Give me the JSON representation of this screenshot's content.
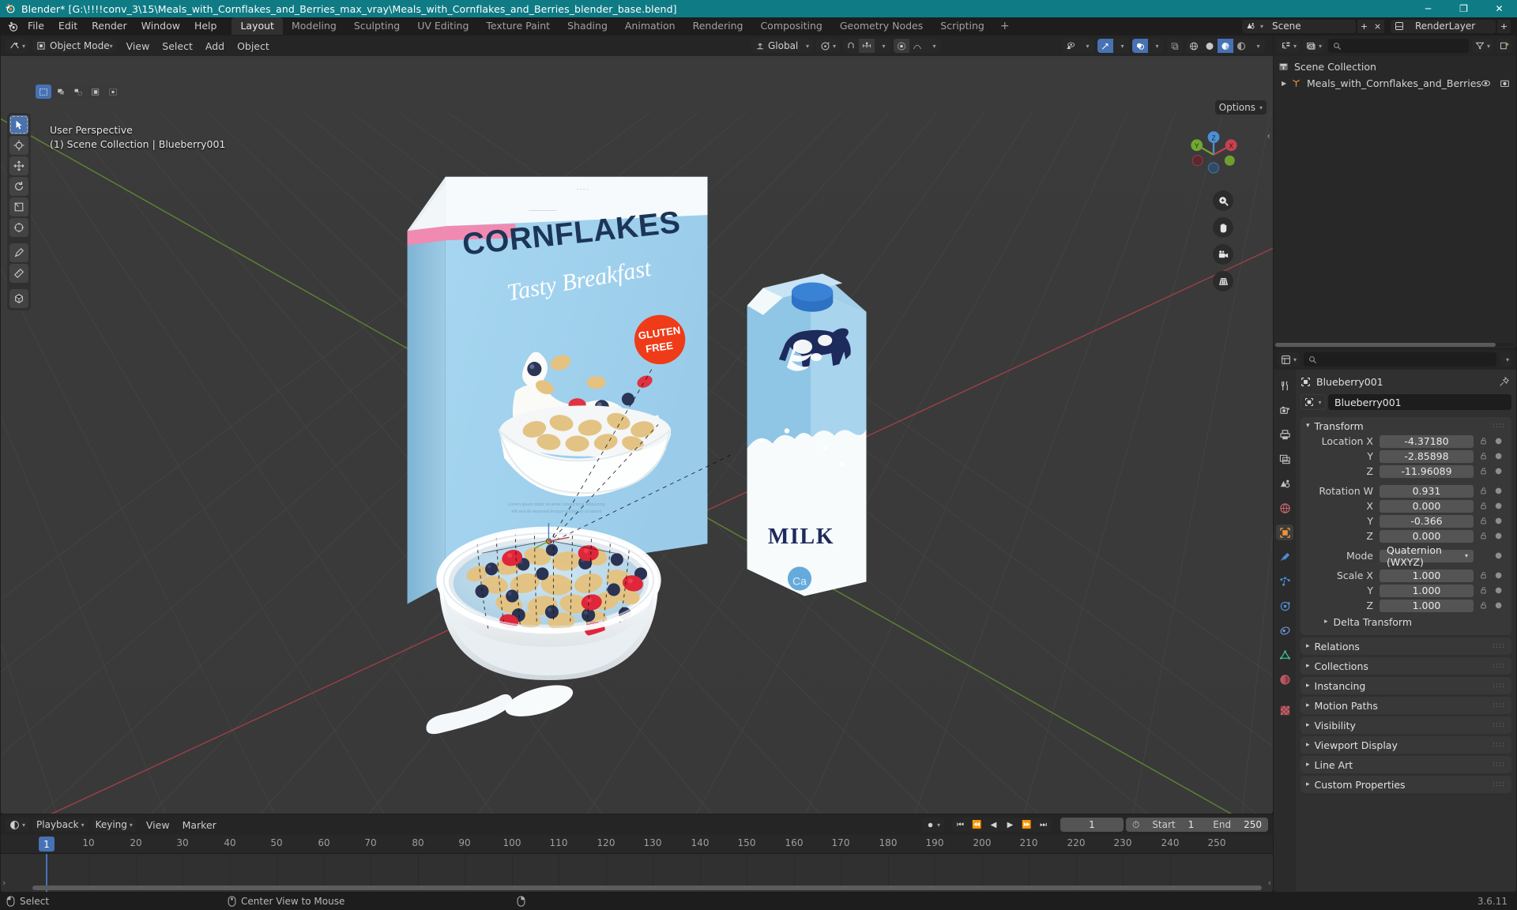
{
  "window": {
    "title": "Blender* [G:\\!!!!conv_3\\15\\Meals_with_Cornflakes_and_Berries_max_vray\\Meals_with_Cornflakes_and_Berries_blender_base.blend]",
    "minimize": "─",
    "maximize": "❐",
    "close": "✕",
    "titlebar_color": "#0f7b85"
  },
  "topbar": {
    "logo_icon": "blender-logo-icon",
    "menus": [
      "File",
      "Edit",
      "Render",
      "Window",
      "Help"
    ],
    "workspaces": [
      {
        "label": "Layout",
        "active": true
      },
      {
        "label": "Modeling",
        "active": false
      },
      {
        "label": "Sculpting",
        "active": false
      },
      {
        "label": "UV Editing",
        "active": false
      },
      {
        "label": "Texture Paint",
        "active": false
      },
      {
        "label": "Shading",
        "active": false
      },
      {
        "label": "Animation",
        "active": false
      },
      {
        "label": "Rendering",
        "active": false
      },
      {
        "label": "Compositing",
        "active": false
      },
      {
        "label": "Geometry Nodes",
        "active": false
      },
      {
        "label": "Scripting",
        "active": false
      }
    ],
    "add_workspace": "+",
    "scene_label": "Scene",
    "viewlayer_label": "RenderLayer"
  },
  "viewport": {
    "mode": "Object Mode",
    "menus": [
      "View",
      "Select",
      "Add",
      "Object"
    ],
    "transform_orientation": "Global",
    "overlay_line_1": "User Perspective",
    "overlay_line_2": "(1) Scene Collection | Blueberry001",
    "options_label": "Options",
    "gizmo_axes": [
      "X",
      "Y",
      "Z"
    ],
    "nav_buttons": [
      "zoom-icon",
      "hand-pan-icon",
      "camera-view-icon",
      "perspective-ortho-icon"
    ],
    "tools": [
      "tweak-select-tool",
      "cursor-tool",
      "move-tool",
      "rotate-tool",
      "scale-tool",
      "transform-tool",
      "annotate-tool",
      "measure-tool",
      "add-cube-tool"
    ],
    "select_modes": [
      "select-box",
      "select-circle",
      "select-lasso",
      "select-extend",
      "select-tweak"
    ],
    "bg_color": "#393939",
    "grid_color": "#5a5a5a",
    "axis_x_color": "#b9404c",
    "axis_y_color": "#6a9e2f"
  },
  "outliner": {
    "display_mode_icon": "outliner-view-layer-icon",
    "filter_icon": "filter-icon",
    "new_collection_icon": "new-collection-icon",
    "search_placeholder": "",
    "rows": [
      {
        "label": "Scene Collection",
        "icon": "scene-collection-icon",
        "indent": false,
        "expand": "",
        "eye": false,
        "cam": false
      },
      {
        "label": "Meals_with_Cornflakes_and_Berries",
        "icon": "empty-axes-icon",
        "indent": true,
        "expand": "▶",
        "eye": true,
        "cam": true
      }
    ]
  },
  "properties": {
    "search_placeholder": "",
    "tabs": [
      {
        "name": "tool-tab",
        "active": false
      },
      {
        "name": "render-tab",
        "active": false
      },
      {
        "name": "output-tab",
        "active": false
      },
      {
        "name": "view-layer-tab",
        "active": false
      },
      {
        "name": "scene-tab",
        "active": false
      },
      {
        "name": "world-tab",
        "active": false
      },
      {
        "name": "object-tab",
        "active": true
      },
      {
        "name": "modifiers-tab",
        "active": false
      },
      {
        "name": "particles-tab",
        "active": false
      },
      {
        "name": "physics-tab",
        "active": false
      },
      {
        "name": "constraints-tab",
        "active": false
      },
      {
        "name": "object-data-tab",
        "active": false
      },
      {
        "name": "material-tab",
        "active": false
      },
      {
        "name": "texture-tab",
        "active": false
      }
    ],
    "breadcrumb_object": "Blueberry001",
    "id_name": "Blueberry001",
    "transform_panel": {
      "title": "Transform",
      "open": true,
      "fields": [
        {
          "label": "Location X",
          "value": "-4.37180",
          "lock": true
        },
        {
          "label": "Y",
          "value": "-2.85898",
          "lock": true
        },
        {
          "label": "Z",
          "value": "-11.96089",
          "lock": true
        },
        {
          "label": "Rotation W",
          "value": "0.931",
          "lock": true,
          "gap_before": true
        },
        {
          "label": "X",
          "value": "0.000",
          "lock": true
        },
        {
          "label": "Y",
          "value": "-0.366",
          "lock": true
        },
        {
          "label": "Z",
          "value": "0.000",
          "lock": true
        },
        {
          "label": "Mode",
          "value": "Quaternion (WXYZ)",
          "dropdown": true,
          "lock": false,
          "gap_before": true
        },
        {
          "label": "Scale X",
          "value": "1.000",
          "lock": true,
          "gap_before": true
        },
        {
          "label": "Y",
          "value": "1.000",
          "lock": true
        },
        {
          "label": "Z",
          "value": "1.000",
          "lock": true
        }
      ],
      "subpanel": "Delta Transform"
    },
    "closed_panels": [
      "Relations",
      "Collections",
      "Instancing",
      "Motion Paths",
      "Visibility",
      "Viewport Display",
      "Line Art",
      "Custom Properties"
    ]
  },
  "timeline": {
    "editor_icon": "timeline-editor-icon",
    "menus": [
      "Playback",
      "Keying",
      "View",
      "Marker"
    ],
    "transport": [
      "⏮",
      "⏪",
      "◀",
      "▶",
      "⏩",
      "⏭"
    ],
    "current_frame": "1",
    "start_label": "Start",
    "start_value": "1",
    "end_label": "End",
    "end_value": "250",
    "ticks": [
      10,
      20,
      30,
      40,
      50,
      60,
      70,
      80,
      90,
      100,
      110,
      120,
      130,
      140,
      150,
      160,
      170,
      180,
      190,
      200,
      210,
      220,
      230,
      240,
      250
    ],
    "playhead_frame": "1",
    "playhead_color": "#4772b3"
  },
  "statusbar": {
    "items": [
      {
        "icon": "mouse-left-icon",
        "label": "Select"
      },
      {
        "icon": "mouse-middle-icon",
        "label": "Center View to Mouse"
      },
      {
        "icon": "mouse-right-icon",
        "label": ""
      }
    ],
    "version": "3.6.11"
  },
  "scene_objects": {
    "cereal_box": {
      "brand": "CORNFLAKES",
      "tagline": "Tasty Breakfast",
      "badge_line_1": "GLUTEN",
      "badge_line_2": "FREE",
      "box_color": "#9fd2ee",
      "title_color": "#1c3557",
      "badge_color": "#ef3b18"
    },
    "milk_carton": {
      "label": "MILK",
      "body_color": "#86c3e8",
      "cap_color": "#2e72c4",
      "cow_color": "#1d2a5c"
    },
    "bowl": {
      "rim_color": "#f2f6f8",
      "milk_color": "#bfdced",
      "flake_color": "#e5c381",
      "blueberry_color": "#2a3352",
      "raspberry_color": "#e0263a"
    }
  }
}
